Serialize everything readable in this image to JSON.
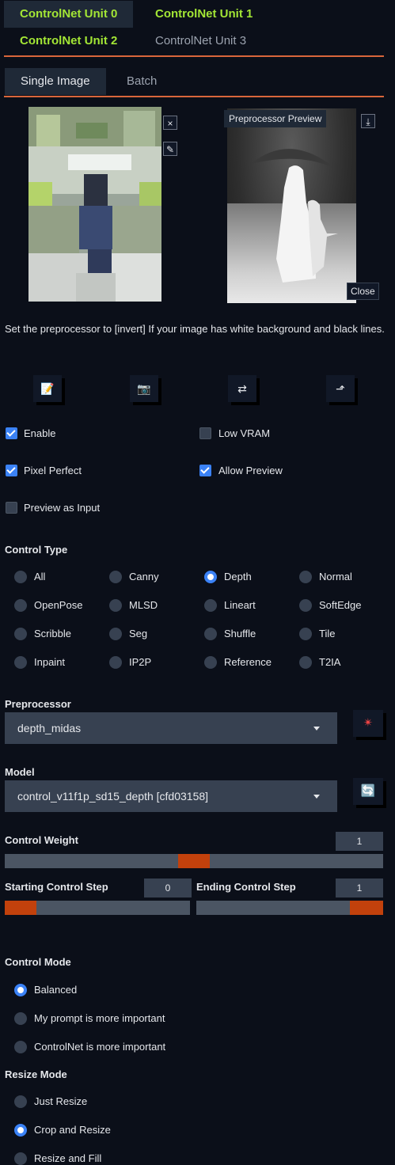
{
  "units": [
    "ControlNet Unit 0",
    "ControlNet Unit 1",
    "ControlNet Unit 2",
    "ControlNet Unit 3"
  ],
  "tabs": [
    "Single Image",
    "Batch"
  ],
  "preview": {
    "label": "Preprocessor Preview",
    "close": "Close"
  },
  "icons": {
    "clear": "×",
    "edit": "✎",
    "download": "⤓"
  },
  "hint": "Set the preprocessor to [invert] If your image has white background and black lines.",
  "tools": [
    {
      "name": "new-canvas-icon",
      "glyph": "📝"
    },
    {
      "name": "camera-icon",
      "glyph": "📷"
    },
    {
      "name": "swap-icon",
      "glyph": "⇄"
    },
    {
      "name": "send-dimensions-icon",
      "glyph": "⬏"
    }
  ],
  "options": {
    "enable": "Enable",
    "low_vram": "Low VRAM",
    "pixel_perfect": "Pixel Perfect",
    "allow_preview": "Allow Preview",
    "preview_as_input": "Preview as Input"
  },
  "control_type": {
    "title": "Control Type",
    "items": [
      "All",
      "Canny",
      "Depth",
      "Normal",
      "OpenPose",
      "MLSD",
      "Lineart",
      "SoftEdge",
      "Scribble",
      "Seg",
      "Shuffle",
      "Tile",
      "Inpaint",
      "IP2P",
      "Reference",
      "T2IA"
    ],
    "selected": "Depth"
  },
  "preprocessor": {
    "title": "Preprocessor",
    "value": "depth_midas",
    "button_icon": "✴"
  },
  "model": {
    "title": "Model",
    "value": "control_v11f1p_sd15_depth [cfd03158]",
    "button_icon": "🔄"
  },
  "control_weight": {
    "title": "Control Weight",
    "value": "1",
    "fraction": 0.5
  },
  "starting_step": {
    "title": "Starting Control Step",
    "value": "0",
    "fraction": 0.0
  },
  "ending_step": {
    "title": "Ending Control Step",
    "value": "1",
    "fraction": 1.0
  },
  "control_mode": {
    "title": "Control Mode",
    "items": [
      "Balanced",
      "My prompt is more important",
      "ControlNet is more important"
    ],
    "selected": "Balanced"
  },
  "resize_mode": {
    "title": "Resize Mode",
    "items": [
      "Just Resize",
      "Crop and Resize",
      "Resize and Fill"
    ],
    "selected": "Crop and Resize"
  },
  "colors": {
    "accent": "#3b82f6",
    "orange": "#d9663b",
    "green": "#a3e635",
    "slider": "#c2410c"
  }
}
